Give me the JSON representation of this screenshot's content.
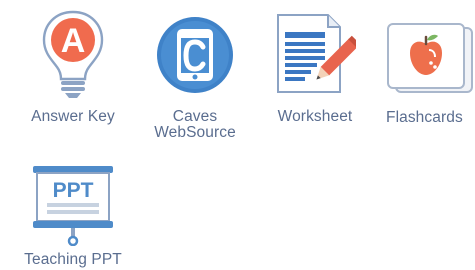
{
  "resources": [
    {
      "id": "answer-key",
      "label": "Answer Key",
      "icon": "lightbulb-letter-a-icon",
      "badge": "A"
    },
    {
      "id": "caves-websource",
      "label_line1": "Caves",
      "label_line2": "WebSource",
      "icon": "mobile-device-icon"
    },
    {
      "id": "worksheet",
      "label": "Worksheet",
      "icon": "document-pencil-icon"
    },
    {
      "id": "flashcards",
      "label": "Flashcards",
      "icon": "apple-card-icon"
    },
    {
      "id": "teaching-ppt",
      "label": "Teaching PPT",
      "icon": "presentation-screen-icon",
      "badge": "PPT"
    }
  ],
  "colors": {
    "label": "#5a6d8f",
    "answer_key_accent": "#f06b4e",
    "websource_blue": "#3f82c8",
    "worksheet_blue": "#3b77c2",
    "pencil_red": "#e8644e",
    "apple_orange": "#ee6f4c",
    "ppt_blue": "#4f8bc9"
  }
}
